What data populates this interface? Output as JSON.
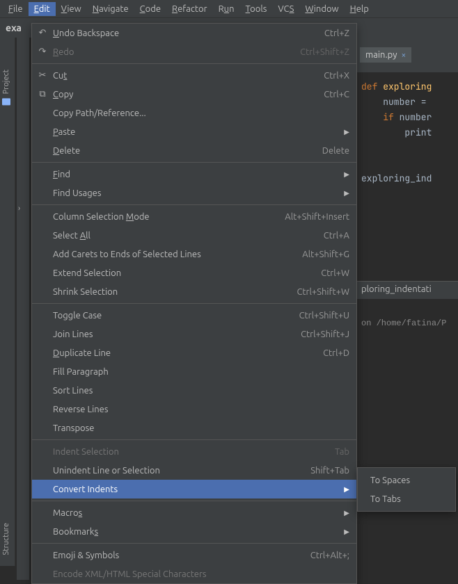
{
  "menubar": [
    {
      "label": "File",
      "accel": "F",
      "active": false
    },
    {
      "label": "Edit",
      "accel": "E",
      "active": true
    },
    {
      "label": "View",
      "accel": "V",
      "active": false
    },
    {
      "label": "Navigate",
      "accel": "N",
      "active": false
    },
    {
      "label": "Code",
      "accel": "C",
      "active": false
    },
    {
      "label": "Refactor",
      "accel": "R",
      "active": false
    },
    {
      "label": "Run",
      "accel": "u",
      "active": false
    },
    {
      "label": "Tools",
      "accel": "T",
      "active": false
    },
    {
      "label": "VCS",
      "accel": "S",
      "active": false
    },
    {
      "label": "Window",
      "accel": "W",
      "active": false
    },
    {
      "label": "Help",
      "accel": "H",
      "active": false
    }
  ],
  "breadcrumb": "exa",
  "side": {
    "project": "Project",
    "structure": "Structure"
  },
  "tab": {
    "filename": "main.py"
  },
  "code": {
    "l1_kw": "def ",
    "l1_fn": "exploring",
    "l2": "    number = ",
    "l3_kw": "    if ",
    "l3_rest": "number",
    "l4": "        print",
    "l5": "exploring_ind"
  },
  "run_label": "ploring_indentati",
  "run_path": "on /home/fatina/P",
  "edit_menu": {
    "group1": [
      {
        "label": "Undo Backspace",
        "accel": "U",
        "shortcut": "Ctrl+Z",
        "sub": false,
        "disabled": false,
        "icon": "undo"
      },
      {
        "label": "Redo",
        "accel": "R",
        "shortcut": "Ctrl+Shift+Z",
        "sub": false,
        "disabled": true,
        "icon": "redo"
      }
    ],
    "group2": [
      {
        "label": "Cut",
        "accel": "t",
        "shortcut": "Ctrl+X",
        "sub": false,
        "disabled": false,
        "icon": "cut"
      },
      {
        "label": "Copy",
        "accel": "C",
        "shortcut": "Ctrl+C",
        "sub": false,
        "disabled": false,
        "icon": "copy"
      },
      {
        "label": "Copy Path/Reference...",
        "accel": "",
        "shortcut": "",
        "sub": false,
        "disabled": false,
        "icon": ""
      },
      {
        "label": "Paste",
        "accel": "P",
        "shortcut": "",
        "sub": true,
        "disabled": false,
        "icon": ""
      },
      {
        "label": "Delete",
        "accel": "D",
        "shortcut": "Delete",
        "sub": false,
        "disabled": false,
        "icon": ""
      }
    ],
    "group3": [
      {
        "label": "Find",
        "accel": "F",
        "shortcut": "",
        "sub": true,
        "disabled": false,
        "icon": ""
      },
      {
        "label": "Find Usages",
        "accel": "",
        "shortcut": "",
        "sub": true,
        "disabled": false,
        "icon": ""
      }
    ],
    "group4": [
      {
        "label": "Column Selection Mode",
        "accel": "M",
        "shortcut": "Alt+Shift+Insert",
        "sub": false,
        "disabled": false,
        "icon": ""
      },
      {
        "label": "Select All",
        "accel": "A",
        "shortcut": "Ctrl+A",
        "sub": false,
        "disabled": false,
        "icon": ""
      },
      {
        "label": "Add Carets to Ends of Selected Lines",
        "accel": "",
        "shortcut": "Alt+Shift+G",
        "sub": false,
        "disabled": false,
        "icon": ""
      },
      {
        "label": "Extend Selection",
        "accel": "",
        "shortcut": "Ctrl+W",
        "sub": false,
        "disabled": false,
        "icon": ""
      },
      {
        "label": "Shrink Selection",
        "accel": "",
        "shortcut": "Ctrl+Shift+W",
        "sub": false,
        "disabled": false,
        "icon": ""
      }
    ],
    "group5": [
      {
        "label": "Toggle Case",
        "accel": "",
        "shortcut": "Ctrl+Shift+U",
        "sub": false,
        "disabled": false,
        "icon": ""
      },
      {
        "label": "Join Lines",
        "accel": "",
        "shortcut": "Ctrl+Shift+J",
        "sub": false,
        "disabled": false,
        "icon": ""
      },
      {
        "label": "Duplicate Line",
        "accel": "D",
        "shortcut": "Ctrl+D",
        "sub": false,
        "disabled": false,
        "icon": ""
      },
      {
        "label": "Fill Paragraph",
        "accel": "",
        "shortcut": "",
        "sub": false,
        "disabled": false,
        "icon": ""
      },
      {
        "label": "Sort Lines",
        "accel": "",
        "shortcut": "",
        "sub": false,
        "disabled": false,
        "icon": ""
      },
      {
        "label": "Reverse Lines",
        "accel": "",
        "shortcut": "",
        "sub": false,
        "disabled": false,
        "icon": ""
      },
      {
        "label": "Transpose",
        "accel": "",
        "shortcut": "",
        "sub": false,
        "disabled": false,
        "icon": ""
      }
    ],
    "group6": [
      {
        "label": "Indent Selection",
        "accel": "",
        "shortcut": "Tab",
        "sub": false,
        "disabled": true,
        "icon": ""
      },
      {
        "label": "Unindent Line or Selection",
        "accel": "",
        "shortcut": "Shift+Tab",
        "sub": false,
        "disabled": false,
        "icon": ""
      },
      {
        "label": "Convert Indents",
        "accel": "",
        "shortcut": "",
        "sub": true,
        "disabled": false,
        "icon": "",
        "highlighted": true
      }
    ],
    "group7": [
      {
        "label": "Macros",
        "accel": "s",
        "shortcut": "",
        "sub": true,
        "disabled": false,
        "icon": ""
      },
      {
        "label": "Bookmarks",
        "accel": "s",
        "shortcut": "",
        "sub": true,
        "disabled": false,
        "icon": ""
      }
    ],
    "group8": [
      {
        "label": "Emoji & Symbols",
        "accel": "",
        "shortcut": "Ctrl+Alt+;",
        "sub": false,
        "disabled": false,
        "icon": ""
      },
      {
        "label": "Encode XML/HTML Special Characters",
        "accel": "",
        "shortcut": "",
        "sub": false,
        "disabled": true,
        "icon": ""
      }
    ]
  },
  "submenu": {
    "items": [
      {
        "label": "To Spaces"
      },
      {
        "label": "To Tabs"
      }
    ]
  }
}
